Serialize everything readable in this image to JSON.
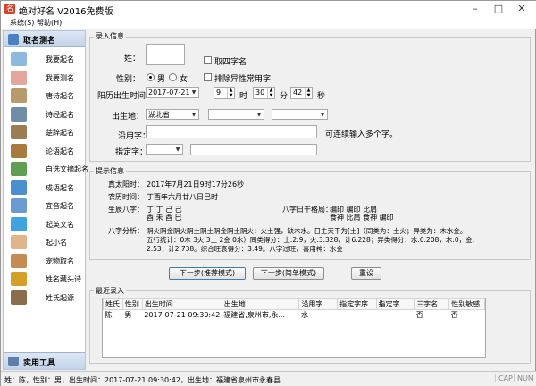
{
  "window": {
    "title": "绝对好名 V2016免费版"
  },
  "menu": {
    "items": [
      {
        "label": "系统(S)"
      },
      {
        "label": "帮助(H)"
      }
    ]
  },
  "sidebar": {
    "header": "取名测名",
    "items": [
      {
        "label": "我要起名",
        "icon": "baby-icon",
        "color": "#8fb8de"
      },
      {
        "label": "我要测名",
        "icon": "baby-icon",
        "color": "#e3a7a0"
      },
      {
        "label": "唐诗起名",
        "icon": "scroll-icon",
        "color": "#b99a6b"
      },
      {
        "label": "诗经起名",
        "icon": "scroll-icon",
        "color": "#6f8da6"
      },
      {
        "label": "楚辞起名",
        "icon": "book-icon",
        "color": "#9c7c52"
      },
      {
        "label": "论语起名",
        "icon": "book-icon",
        "color": "#a87a3e"
      },
      {
        "label": "自选文摘起名",
        "icon": "document-icon",
        "color": "#5e9f52"
      },
      {
        "label": "成语起名",
        "icon": "hanzi-icon",
        "color": "#4a8fd0"
      },
      {
        "label": "宜音起名",
        "icon": "user-icon",
        "color": "#6c9bd1"
      },
      {
        "label": "起英文名",
        "icon": "globe-icon",
        "color": "#3fa4de"
      },
      {
        "label": "起小名",
        "icon": "baby-icon",
        "color": "#e2b48c"
      },
      {
        "label": "宠物取名",
        "icon": "pet-icon",
        "color": "#c48b52"
      },
      {
        "label": "姓名藏头诗",
        "icon": "poem-icon",
        "color": "#d4a02a"
      },
      {
        "label": "姓氏起源",
        "icon": "book-icon",
        "color": "#8a6d4b"
      }
    ],
    "footer": "实用工具"
  },
  "input_group": {
    "title": "录入信息",
    "surname_label": "姓：",
    "surname_value": "",
    "four_char_label": "取四字名",
    "exclude_rare_label": "排除异性常用字",
    "gender_label": "性别：",
    "gender_male": "男",
    "gender_female": "女",
    "birth_label": "阳历出生时间：",
    "birth_date": "2017-07-21",
    "hour_value": "9",
    "hour_unit": "时",
    "minute_value": "30",
    "minute_unit": "分",
    "second_value": "42",
    "second_unit": "秒",
    "birthplace_label": "出生地：",
    "province_value": "湖北省",
    "city_value": "",
    "district_value": "",
    "used_char_label": "沿用字：",
    "used_char_value": "",
    "used_char_hint": "可连续输入多个字。",
    "specified_char_label": "指定字：",
    "specified_pos_value": "",
    "specified_char_value": ""
  },
  "hint_group": {
    "title": "提示信息",
    "true_solar_label": "真太阳时：",
    "true_solar_value": "2017年7月21日9时17分26秒",
    "lunar_label": "农历时间：",
    "lunar_value": "丁酉年六月廿八日巳时",
    "bazi_label": "生辰八字：",
    "bazi_row1": "丁 丁 己 己",
    "bazi_row2": "酉 未 酉 巳",
    "gejuleft_label": "八字日干格局：",
    "geju_row1": "编印    编印          比肩",
    "geju_row2": "食神  比肩  食神  编印",
    "analysis_label": "八字分析：",
    "analysis_line1": "阴火阴金阴火阴土阴土阴金阴土阴火：火土强，缺木水。日主天干为[土]（同类为：土火；异类为：木水金。",
    "analysis_line2": "五行统计：0木 3火 3土 2金 0水）同类得分：土:2.9，火:3.328，计6.228；异类得分：水:0.208，木:0，金:",
    "analysis_line3": "2.53，计2.738。综合旺衰得分：3.49。八字过旺，喜用神：水金"
  },
  "buttons": {
    "next_recommended": "下一步(推荐模式)",
    "next_simple": "下一步(简单模式)",
    "reset": "重设"
  },
  "recent_group": {
    "title": "最近录入",
    "columns": [
      "姓氏",
      "性别",
      "出生时间",
      "出生地",
      "沿用字",
      "指定字序",
      "指定字",
      "三字名",
      "性别敏感"
    ],
    "rows": [
      [
        "陈",
        "男",
        "2017-07-21 09:30:42",
        "福建省,泉州市,永...",
        "水",
        "",
        "",
        "否",
        "否"
      ]
    ]
  },
  "status": {
    "text": "姓：陈，性别：男，出生时间：2017-07-21 09:30:42，出生地：福建省泉州市永春县",
    "cap": "CAP",
    "num": "NUM"
  }
}
